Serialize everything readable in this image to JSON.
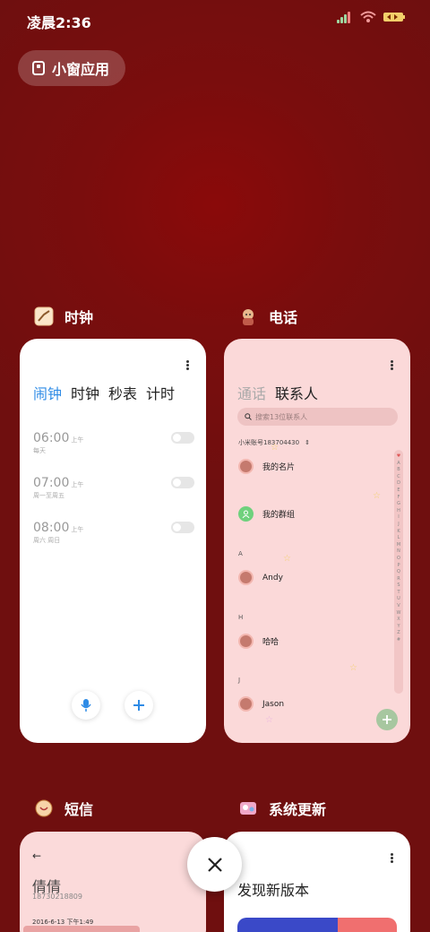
{
  "status_bar": {
    "time": "凌晨2:36"
  },
  "floating_window": {
    "label": "小窗应用"
  },
  "apps": {
    "clock": {
      "name": "时钟",
      "tabs": [
        "闹钟",
        "时钟",
        "秒表",
        "计时"
      ],
      "alarms": [
        {
          "time": "06:00",
          "ampm": "上午",
          "repeat": "每天",
          "enabled": false
        },
        {
          "time": "07:00",
          "ampm": "上午",
          "repeat": "周一至周五",
          "enabled": false
        },
        {
          "time": "08:00",
          "ampm": "上午",
          "repeat": "周六 周日",
          "enabled": false
        }
      ]
    },
    "phone": {
      "name": "电话",
      "tabs": [
        "通话",
        "联系人"
      ],
      "search_placeholder": "搜索13位联系人",
      "mi_account": "小米账号183704430",
      "my_card": "我的名片",
      "my_group": "我的群组",
      "sections": [
        "A",
        "H",
        "J"
      ],
      "contacts": [
        "Andy",
        "哈哈",
        "Jason"
      ],
      "index_letters": [
        "♥",
        "A",
        "B",
        "C",
        "D",
        "E",
        "F",
        "G",
        "H",
        "I",
        "J",
        "K",
        "L",
        "M",
        "N",
        "O",
        "P",
        "Q",
        "R",
        "S",
        "T",
        "U",
        "V",
        "W",
        "X",
        "Y",
        "Z",
        "#"
      ]
    },
    "sms": {
      "name": "短信",
      "contact": "倩倩",
      "number": "18730218809",
      "date": "2016-6-13 下午1:49"
    },
    "update": {
      "name": "系统更新",
      "title": "发现新版本"
    }
  }
}
